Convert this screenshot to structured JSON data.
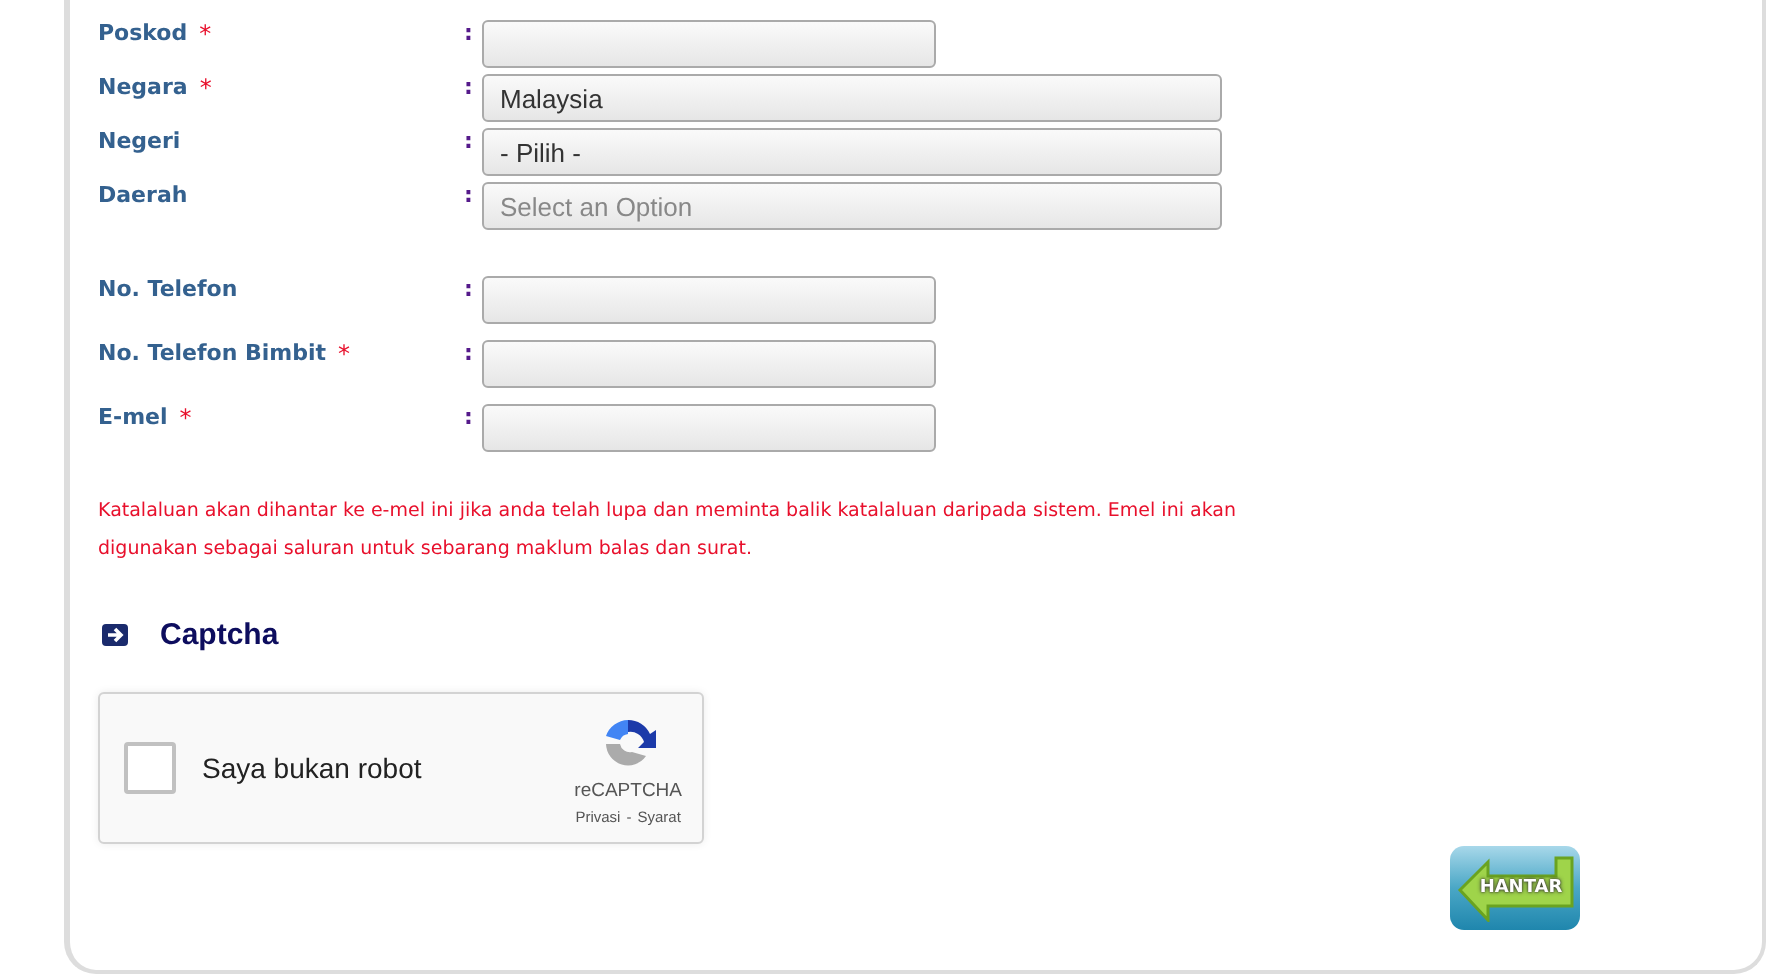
{
  "form": {
    "field_groups": [
      [
        {
          "label": "Poskod",
          "required": true,
          "kind": "text"
        },
        {
          "label": "Negara",
          "required": true,
          "kind": "select",
          "value": "Malaysia"
        },
        {
          "label": "Negeri",
          "required": false,
          "kind": "select",
          "value": "- Pilih -"
        },
        {
          "label": "Daerah",
          "required": false,
          "kind": "select",
          "placeholder": "Select an Option"
        }
      ],
      [
        {
          "label": "No. Telefon",
          "required": false,
          "kind": "text"
        },
        {
          "label": "No. Telefon Bimbit",
          "required": true,
          "kind": "text"
        },
        {
          "label": "E-mel",
          "required": true,
          "kind": "text"
        }
      ]
    ],
    "separator": ":",
    "required_mark": "*",
    "note": "Katalaluan akan dihantar ke e-mel ini jika anda telah lupa dan meminta balik katalaluan daripada sistem. Emel ini akan digunakan sebagai saluran untuk sebarang maklum balas dan surat."
  },
  "captcha": {
    "heading": "Captcha",
    "checked": false,
    "label": "Saya bukan robot",
    "brand": "reCAPTCHA",
    "links": [
      "Privasi",
      "Syarat"
    ],
    "link_separator": "-"
  },
  "submit": {
    "label": "HANTAR"
  }
}
